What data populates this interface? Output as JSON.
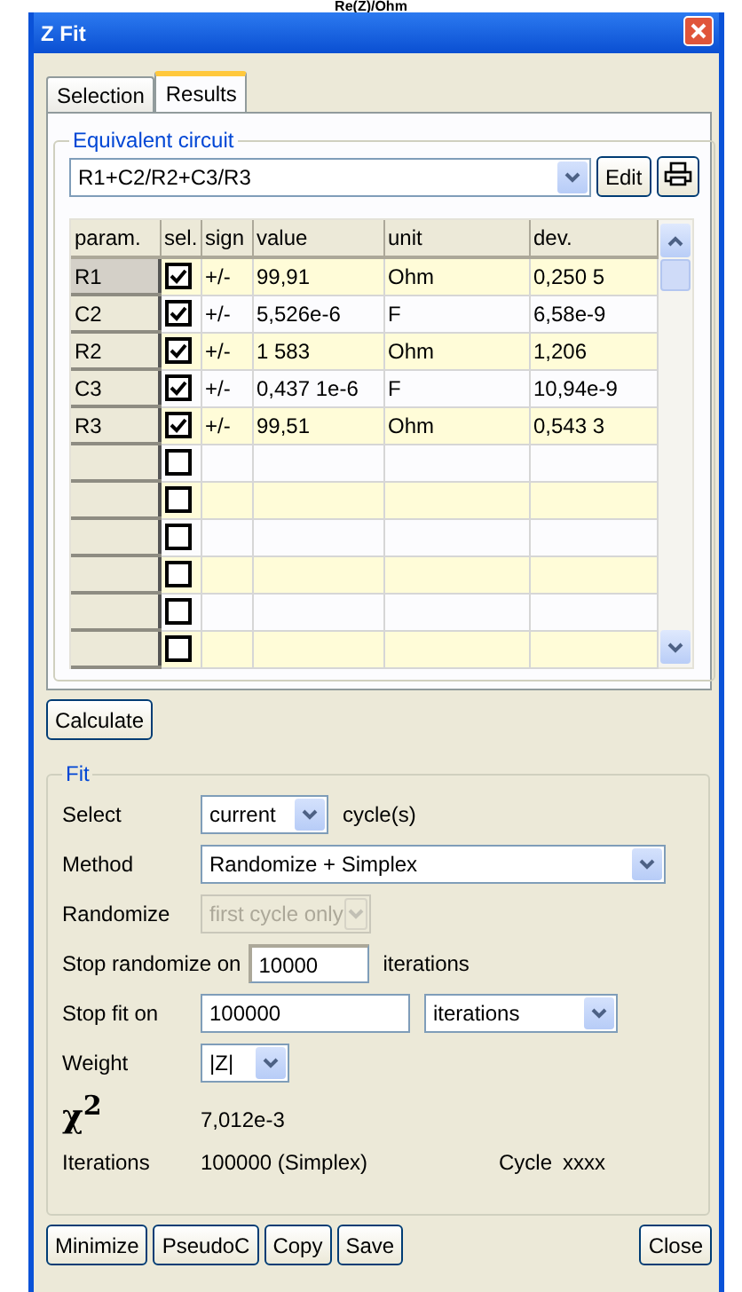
{
  "caption": "Re(Z)/Ohm",
  "window": {
    "title": "Z Fit"
  },
  "tabs": [
    {
      "label": "Selection",
      "selected": false
    },
    {
      "label": "Results",
      "selected": true
    }
  ],
  "equivalent_circuit": {
    "legend": "Equivalent circuit",
    "value": "R1+C2/R2+C3/R3",
    "edit_button": "Edit"
  },
  "table": {
    "columns": [
      "param.",
      "sel.",
      "sign",
      "value",
      "unit",
      "dev."
    ],
    "rows": [
      {
        "param": "R1",
        "selected": true,
        "checked": true,
        "sign": "+/-",
        "value": "99,91",
        "unit": "Ohm",
        "dev": "0,250 5"
      },
      {
        "param": "C2",
        "selected": false,
        "checked": true,
        "sign": "+/-",
        "value": "5,526e-6",
        "unit": "F",
        "dev": "6,58e-9"
      },
      {
        "param": "R2",
        "selected": false,
        "checked": true,
        "sign": "+/-",
        "value": "1 583",
        "unit": "Ohm",
        "dev": "1,206"
      },
      {
        "param": "C3",
        "selected": false,
        "checked": true,
        "sign": "+/-",
        "value": "0,437 1e-6",
        "unit": "F",
        "dev": "10,94e-9"
      },
      {
        "param": "R3",
        "selected": false,
        "checked": true,
        "sign": "+/-",
        "value": "99,51",
        "unit": "Ohm",
        "dev": "0,543 3"
      },
      {
        "selected": false,
        "checked": false
      },
      {
        "selected": false,
        "checked": false
      },
      {
        "selected": false,
        "checked": false
      },
      {
        "selected": false,
        "checked": false
      },
      {
        "selected": false,
        "checked": false
      },
      {
        "selected": false,
        "checked": false
      }
    ]
  },
  "calculate_button": "Calculate",
  "fit": {
    "legend": "Fit",
    "select": {
      "label": "Select",
      "value": "current",
      "suffix": "cycle(s)"
    },
    "method": {
      "label": "Method",
      "value": "Randomize + Simplex"
    },
    "randomize": {
      "label": "Randomize",
      "value": "first cycle only",
      "disabled": true
    },
    "stop_randomize": {
      "label": "Stop randomize on",
      "value": "10000",
      "suffix": "iterations"
    },
    "stop_fit": {
      "label": "Stop fit on",
      "value": "100000",
      "unit": "iterations"
    },
    "weight": {
      "label": "Weight",
      "value": "|Z|"
    },
    "chi": {
      "label": "χ$^{2}$",
      "value": "7,012e-3"
    },
    "iterations": {
      "label": "Iterations",
      "value": "100000 (Simplex)",
      "cycle_label": "Cycle",
      "cycle_value": "xxxx"
    }
  },
  "buttons": [
    "Minimize",
    "PseudoC",
    "Copy",
    "Save",
    "Close"
  ]
}
